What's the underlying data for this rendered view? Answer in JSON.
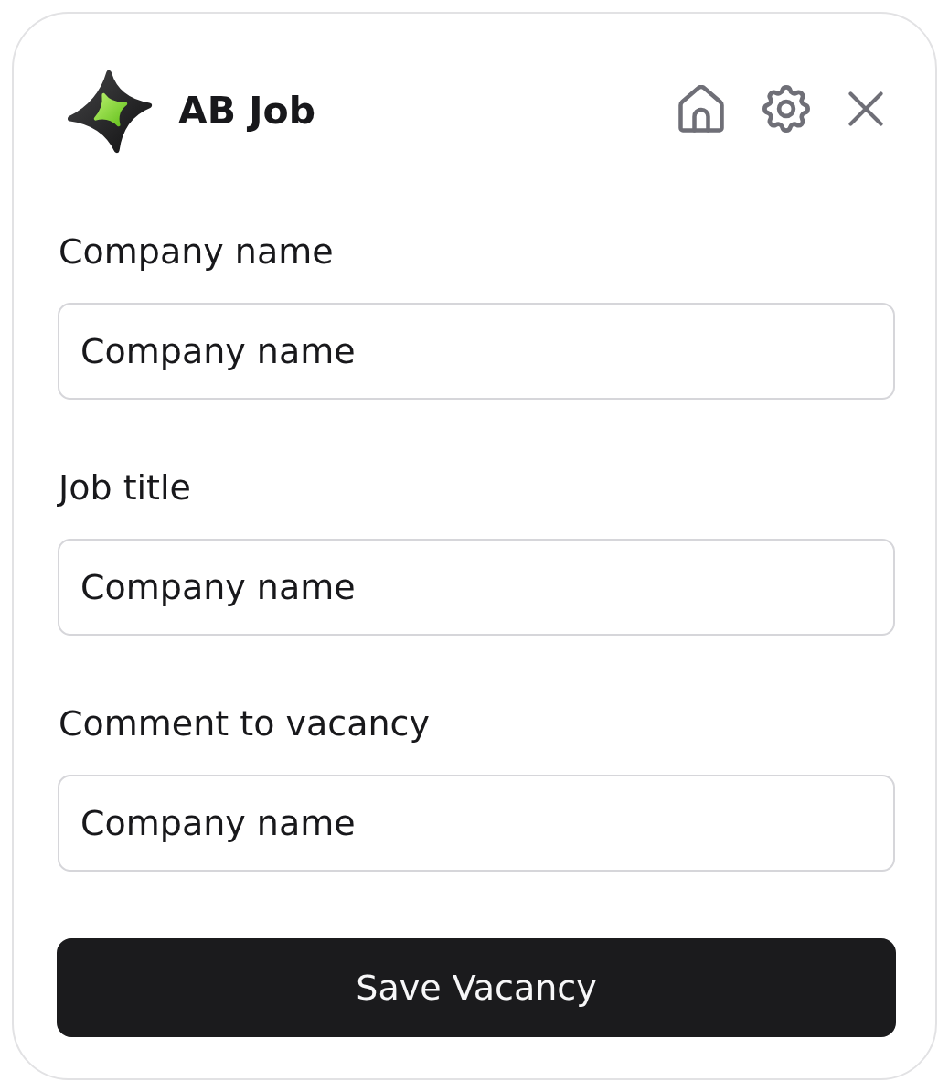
{
  "app": {
    "title": "AB Job"
  },
  "fields": [
    {
      "label": "Company name",
      "value": "Company name"
    },
    {
      "label": "Job title",
      "value": "Company name"
    },
    {
      "label": "Comment to vacancy",
      "value": "Company name"
    }
  ],
  "submit_button": {
    "label": "Save Vacancy"
  }
}
